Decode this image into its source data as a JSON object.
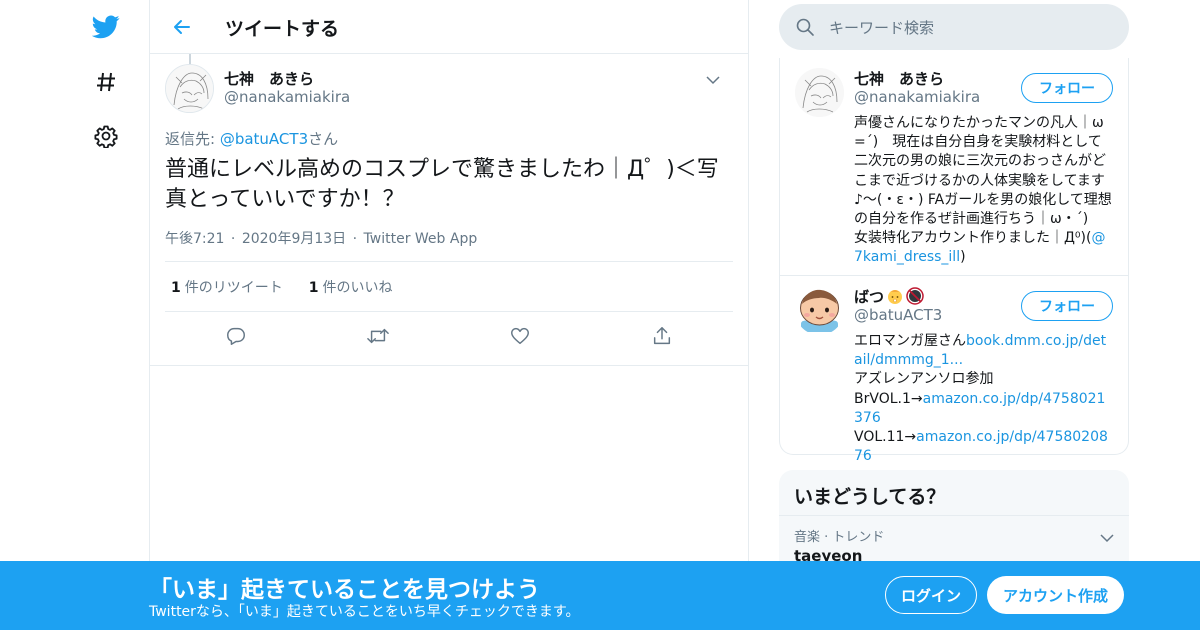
{
  "colors": {
    "accent": "#1da1f2",
    "link": "#1b95e0",
    "muted": "#657786",
    "text": "#14171a",
    "border": "#e6ecf0"
  },
  "nav": {
    "items": [
      {
        "icon": "twitter-logo-icon"
      },
      {
        "icon": "hashtag-icon"
      },
      {
        "icon": "settings-gear-icon"
      }
    ]
  },
  "header": {
    "title": "ツイートする"
  },
  "tweet": {
    "author_name": "七神　あきら",
    "author_handle": "@nanakamiakira",
    "reply_prefix": "返信先: ",
    "reply_handle": "@batuACT3",
    "reply_suffix": "さん",
    "text": "普通にレベル高めのコスプレで驚きましたわ｜Д゜)＜写真とっていいですか！？",
    "time": "午後7:21",
    "date": "2020年9月13日",
    "source": "Twitter Web App",
    "separator": "·",
    "retweet_count": "1",
    "retweet_label": "件のリツイート",
    "like_count": "1",
    "like_label": "件のいいね"
  },
  "search": {
    "placeholder": "キーワード検索"
  },
  "users": [
    {
      "name": "七神　あきら",
      "handle": "@nanakamiakira",
      "follow_label": "フォロー",
      "bio_text": "声優さんになりたかったマンの凡人｜ω=´)　現在は自分自身を実験材料として二次元の男の娘に三次元のおっさんがどこまで近づけるかの人体実験をしてます♪～(・ε・) FAガールを男の娘化して理想の自分を作るぜ計画進行ちう｜ω・´)　 女装特化アカウント作りました｜Д⁰)(",
      "bio_link": "@7kami_dress_ill",
      "bio_end": ")"
    },
    {
      "name": "ばつ",
      "handle": "@batuACT3",
      "follow_label": "フォロー",
      "bio_line1": "エロマンガ屋さん",
      "bio_link1": "book.dmm.co.jp/detail/dmmmg_1...",
      "bio_line2": "アズレンアンソロ参加",
      "bio_line3_prefix": "BrVOL.1→",
      "bio_link2": "amazon.co.jp/dp/4758021376",
      "bio_line4_prefix": "VOL.11→",
      "bio_link3": "amazon.co.jp/dp/4758020876"
    }
  ],
  "trends": {
    "title": "いまどうしてる？",
    "items": [
      {
        "category": "音楽 · トレンド",
        "name": "taeyeon"
      }
    ]
  },
  "banner": {
    "title": "「いま」起きていることを見つけよう",
    "subtitle": "Twitterなら、「いま」起きていることをいち早くチェックできます。",
    "login_label": "ログイン",
    "signup_label": "アカウント作成"
  }
}
